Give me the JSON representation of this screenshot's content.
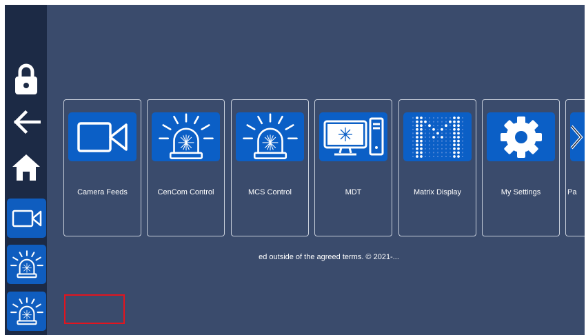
{
  "sidebar": {
    "items": [
      {
        "icon": "lock-icon"
      },
      {
        "icon": "arrow-left-icon"
      },
      {
        "icon": "home-icon"
      },
      {
        "icon": "camera-icon",
        "selected": true
      },
      {
        "icon": "siren-icon"
      },
      {
        "icon": "siren-icon"
      }
    ]
  },
  "tiles": [
    {
      "label": "Camera Feeds",
      "icon": "camera-icon"
    },
    {
      "label": "CenCom Control",
      "icon": "siren-icon"
    },
    {
      "label": "MCS Control",
      "icon": "siren-icon"
    },
    {
      "label": "MDT",
      "icon": "computer-icon"
    },
    {
      "label": "Matrix Display",
      "icon": "matrix-m-icon"
    },
    {
      "label": "My Settings",
      "icon": "gear-icon"
    },
    {
      "label": "Pa",
      "icon": "partial-icon"
    }
  ],
  "scroll": {
    "icon": "chevron-right-icon"
  },
  "footer": {
    "copyright": "ed outside of the agreed terms. © 2021-..."
  },
  "colors": {
    "background": "#3a4b6c",
    "sidebar": "#1c2a45",
    "tile_blue": "#0b5fc6",
    "focus_red": "#e3141e"
  }
}
